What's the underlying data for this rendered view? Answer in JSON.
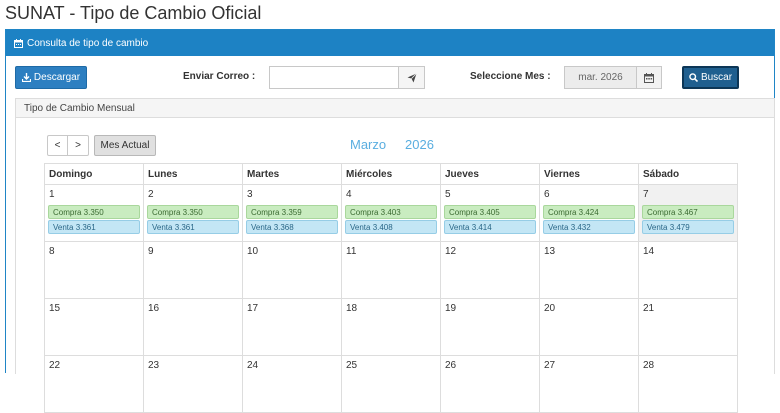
{
  "page": {
    "title": "SUNAT - Tipo de Cambio Oficial"
  },
  "panel": {
    "header": "Consulta de tipo de cambio"
  },
  "toolbar": {
    "download_label": "Descargar",
    "email_label": "Enviar Correo :",
    "email_value": "",
    "month_label": "Seleccione Mes :",
    "month_value": "mar. 2026",
    "search_label": "Buscar"
  },
  "calendar": {
    "section_title": "Tipo de Cambio Mensual",
    "prev_label": "<",
    "next_label": ">",
    "today_label": "Mes Actual",
    "month_name": "Marzo",
    "year": "2026",
    "weekdays": [
      "Domingo",
      "Lunes",
      "Martes",
      "Miércoles",
      "Jueves",
      "Viernes",
      "Sábado"
    ],
    "weeks": [
      [
        {
          "day": "1",
          "compra": "Compra 3.350",
          "venta": "Venta 3.361"
        },
        {
          "day": "2",
          "compra": "Compra 3.350",
          "venta": "Venta 3.361"
        },
        {
          "day": "3",
          "compra": "Compra 3.359",
          "venta": "Venta 3.368"
        },
        {
          "day": "4",
          "compra": "Compra 3.403",
          "venta": "Venta 3.408"
        },
        {
          "day": "5",
          "compra": "Compra 3.405",
          "venta": "Venta 3.414"
        },
        {
          "day": "6",
          "compra": "Compra 3.424",
          "venta": "Venta 3.432"
        },
        {
          "day": "7",
          "compra": "Compra 3.467",
          "venta": "Venta 3.479"
        }
      ],
      [
        {
          "day": "8"
        },
        {
          "day": "9"
        },
        {
          "day": "10"
        },
        {
          "day": "11"
        },
        {
          "day": "12"
        },
        {
          "day": "13"
        },
        {
          "day": "14"
        }
      ],
      [
        {
          "day": "15"
        },
        {
          "day": "16"
        },
        {
          "day": "17"
        },
        {
          "day": "18"
        },
        {
          "day": "19"
        },
        {
          "day": "20"
        },
        {
          "day": "21"
        }
      ],
      [
        {
          "day": "22"
        },
        {
          "day": "23"
        },
        {
          "day": "24"
        },
        {
          "day": "25"
        },
        {
          "day": "26"
        },
        {
          "day": "27"
        },
        {
          "day": "28"
        }
      ]
    ],
    "highlighted_day": "7"
  },
  "icons": {
    "header": "calendar-icon",
    "download": "download-icon",
    "send": "paper-plane-icon",
    "month_picker": "calendar-icon",
    "search": "search-icon"
  },
  "colors": {
    "header_blue": "#1d82c4",
    "buscar_button": "#1f5f8f",
    "descargar_button": "#2d7fc1",
    "compra_badge": "#c9ecc0",
    "venta_badge": "#c3e6f5",
    "month_title": "#5aaee0"
  }
}
